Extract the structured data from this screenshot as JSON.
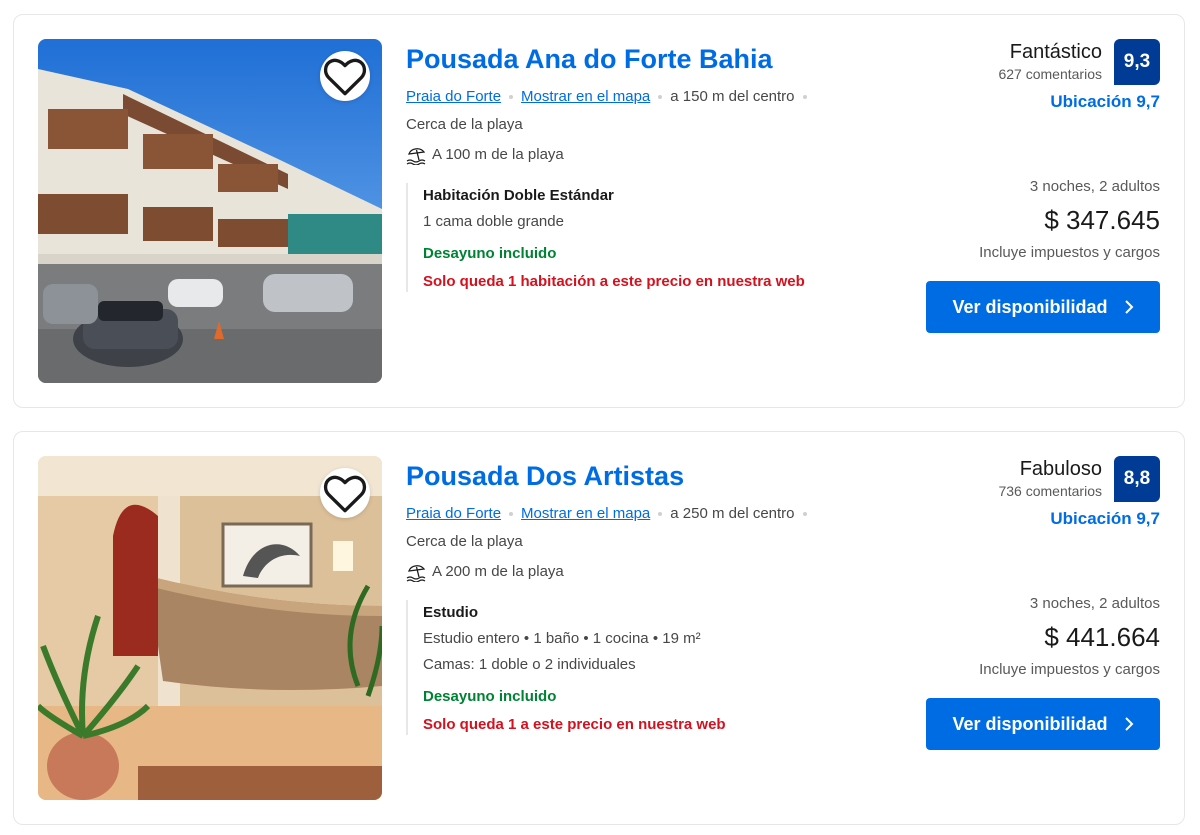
{
  "listings": [
    {
      "name": "Pousada Ana do Forte Bahia",
      "area": "Praia do Forte",
      "map_link": "Mostrar en el mapa",
      "distance_center": "a 150 m del centro",
      "near_text": "Cerca de la playa",
      "beach_distance": "A 100 m de la playa",
      "room_name": "Habitación Doble Estándar",
      "room_details": "1 cama doble grande",
      "room_beds": "",
      "breakfast": "Desayuno incluido",
      "availability_note": "Solo queda 1 habitación a este precio en nuestra web",
      "rating_word": "Fantástico",
      "reviews": "627 comentarios",
      "score": "9,3",
      "location_score": "Ubicación 9,7",
      "stay": "3 noches, 2 adultos",
      "price": "$ 347.645",
      "taxes": "Incluye impuestos y cargos",
      "cta": "Ver disponibilidad"
    },
    {
      "name": "Pousada Dos Artistas",
      "area": "Praia do Forte",
      "map_link": "Mostrar en el mapa",
      "distance_center": "a 250 m del centro",
      "near_text": "Cerca de la playa",
      "beach_distance": "A 200 m de la playa",
      "room_name": "Estudio",
      "room_details": "Estudio entero • 1 baño • 1 cocina • 19 m²",
      "room_beds": "Camas: 1 doble o 2 individuales",
      "breakfast": "Desayuno incluido",
      "availability_note": "Solo queda 1 a este precio en nuestra web",
      "rating_word": "Fabuloso",
      "reviews": "736 comentarios",
      "score": "8,8",
      "location_score": "Ubicación 9,7",
      "stay": "3 noches, 2 adultos",
      "price": "$ 441.664",
      "taxes": "Incluye impuestos y cargos",
      "cta": "Ver disponibilidad"
    }
  ],
  "icons": {
    "favorite": "heart-icon",
    "beach": "beach-umbrella-icon",
    "cta_arrow": "chevron-right-icon"
  },
  "colors": {
    "link_blue": "#006ce4",
    "score_bg": "#003b95",
    "breakfast_green": "#008234",
    "scarcity_red": "#d4111e"
  }
}
